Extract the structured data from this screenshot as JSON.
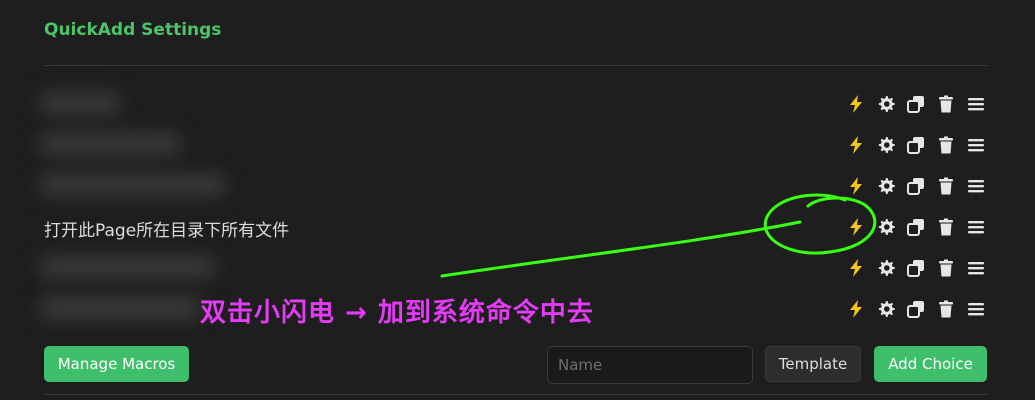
{
  "page": {
    "title": "QuickAdd Settings"
  },
  "choices": [
    {
      "label": ""
    },
    {
      "label": ""
    },
    {
      "label": ""
    },
    {
      "label": "打开此Page所在目录下所有文件"
    },
    {
      "label": ""
    },
    {
      "label": ""
    }
  ],
  "row_actions": [
    "lightning-icon",
    "gear-icon",
    "duplicate-icon",
    "trash-icon",
    "drag-handle-icon"
  ],
  "colors": {
    "accent": "#4cc46a",
    "lightning": "#f5c518",
    "annotation_green": "#39ff14",
    "annotation_magenta": "#e43cf5"
  },
  "annotation": {
    "text": "双击小闪电 → 加到系统命令中去"
  },
  "footer": {
    "manage_macros": "Manage Macros",
    "name_placeholder": "Name",
    "template": "Template",
    "add_choice": "Add Choice"
  }
}
